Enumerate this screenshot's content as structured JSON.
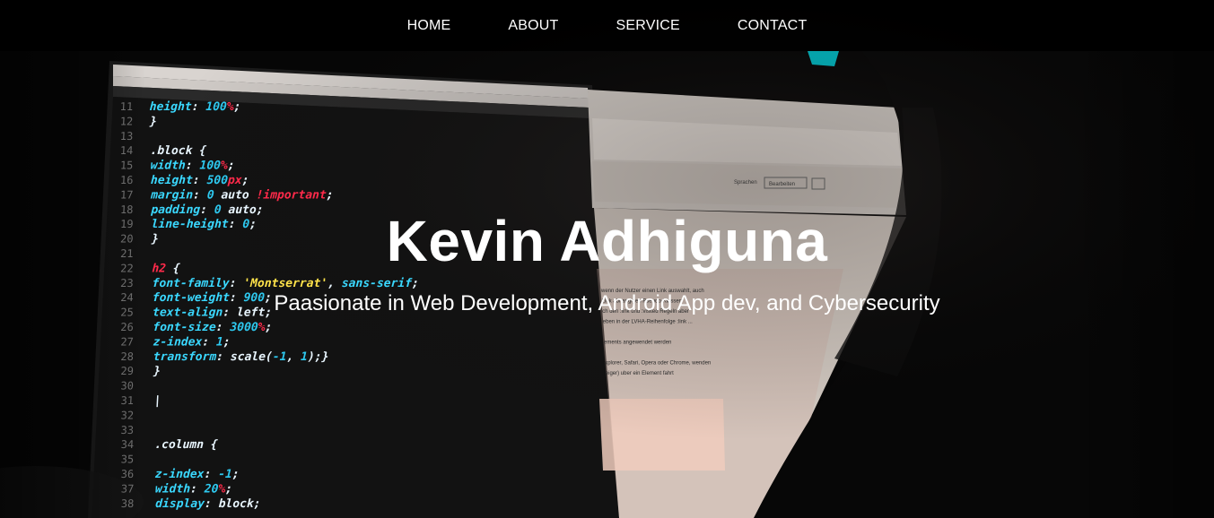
{
  "nav": {
    "items": [
      {
        "label": "HOME"
      },
      {
        "label": "ABOUT"
      },
      {
        "label": "SERVICE"
      },
      {
        "label": "CONTACT"
      }
    ]
  },
  "hero": {
    "title": "Kevin Adhiguna",
    "subtitle": "Paasionate in Web Development, Android App dev, and Cybersecurity"
  },
  "code_lines": [
    {
      "n": "11",
      "parts": [
        {
          "t": "    height",
          "c": "key"
        },
        {
          "t": ": ",
          "c": "w"
        },
        {
          "t": "100",
          "c": "num"
        },
        {
          "t": "%",
          "c": "unit"
        },
        {
          "t": ";",
          "c": "w"
        }
      ]
    },
    {
      "n": "12",
      "parts": [
        {
          "t": "}",
          "c": "w"
        }
      ]
    },
    {
      "n": "13",
      "parts": []
    },
    {
      "n": "14",
      "parts": [
        {
          "t": ".block {",
          "c": "w"
        }
      ]
    },
    {
      "n": "15",
      "parts": [
        {
          "t": "width",
          "c": "key"
        },
        {
          "t": ": ",
          "c": "w"
        },
        {
          "t": "100",
          "c": "num"
        },
        {
          "t": "%",
          "c": "unit"
        },
        {
          "t": ";",
          "c": "w"
        }
      ]
    },
    {
      "n": "16",
      "parts": [
        {
          "t": "height",
          "c": "key"
        },
        {
          "t": ": ",
          "c": "w"
        },
        {
          "t": "500",
          "c": "num"
        },
        {
          "t": "px",
          "c": "unit"
        },
        {
          "t": ";",
          "c": "w"
        }
      ]
    },
    {
      "n": "17",
      "parts": [
        {
          "t": "margin",
          "c": "key"
        },
        {
          "t": ": ",
          "c": "w"
        },
        {
          "t": "0",
          "c": "num"
        },
        {
          "t": " auto ",
          "c": "w"
        },
        {
          "t": "!important",
          "c": "unit"
        },
        {
          "t": ";",
          "c": "w"
        }
      ]
    },
    {
      "n": "18",
      "parts": [
        {
          "t": "padding",
          "c": "key"
        },
        {
          "t": ": ",
          "c": "w"
        },
        {
          "t": "0",
          "c": "num"
        },
        {
          "t": " auto;",
          "c": "w"
        }
      ]
    },
    {
      "n": "19",
      "parts": [
        {
          "t": "line-height",
          "c": "key"
        },
        {
          "t": ": ",
          "c": "w"
        },
        {
          "t": "0",
          "c": "num"
        },
        {
          "t": ";",
          "c": "w"
        }
      ]
    },
    {
      "n": "20",
      "parts": [
        {
          "t": "}",
          "c": "w"
        }
      ]
    },
    {
      "n": "21",
      "parts": []
    },
    {
      "n": "22",
      "parts": [
        {
          "t": "h2",
          "c": "unit"
        },
        {
          "t": " {",
          "c": "w"
        }
      ]
    },
    {
      "n": "23",
      "parts": [
        {
          "t": "    font-family",
          "c": "key"
        },
        {
          "t": ": ",
          "c": "w"
        },
        {
          "t": "'Montserrat'",
          "c": "str"
        },
        {
          "t": ", ",
          "c": "w"
        },
        {
          "t": "sans-serif",
          "c": "key"
        },
        {
          "t": ";",
          "c": "w"
        }
      ]
    },
    {
      "n": "24",
      "parts": [
        {
          "t": "    font-weight",
          "c": "key"
        },
        {
          "t": ": ",
          "c": "w"
        },
        {
          "t": "900",
          "c": "num"
        },
        {
          "t": ";",
          "c": "w"
        }
      ]
    },
    {
      "n": "25",
      "parts": [
        {
          "t": "    text-align",
          "c": "key"
        },
        {
          "t": ": left;",
          "c": "w"
        }
      ]
    },
    {
      "n": "26",
      "parts": [
        {
          "t": "    font-size",
          "c": "key"
        },
        {
          "t": ": ",
          "c": "w"
        },
        {
          "t": "3000",
          "c": "num"
        },
        {
          "t": "%",
          "c": "unit"
        },
        {
          "t": ";",
          "c": "w"
        }
      ]
    },
    {
      "n": "27",
      "parts": [
        {
          "t": "    z-index",
          "c": "key"
        },
        {
          "t": ": ",
          "c": "w"
        },
        {
          "t": "1",
          "c": "num"
        },
        {
          "t": ";",
          "c": "w"
        }
      ]
    },
    {
      "n": "28",
      "parts": [
        {
          "t": "    transform",
          "c": "key"
        },
        {
          "t": ": scale(",
          "c": "w"
        },
        {
          "t": "-1",
          "c": "num"
        },
        {
          "t": ", ",
          "c": "w"
        },
        {
          "t": "1",
          "c": "num"
        },
        {
          "t": ");}",
          "c": "w"
        }
      ]
    },
    {
      "n": "29",
      "parts": [
        {
          "t": "}",
          "c": "w"
        }
      ]
    },
    {
      "n": "30",
      "parts": []
    },
    {
      "n": "31",
      "parts": [
        {
          "t": "|",
          "c": "w"
        }
      ]
    },
    {
      "n": "32",
      "parts": []
    },
    {
      "n": "33",
      "parts": []
    },
    {
      "n": "34",
      "parts": [
        {
          "t": " .column {",
          "c": "w"
        }
      ]
    },
    {
      "n": "35",
      "parts": []
    },
    {
      "n": "36",
      "parts": [
        {
          "t": "    z-index",
          "c": "key"
        },
        {
          "t": ": ",
          "c": "w"
        },
        {
          "t": "-1",
          "c": "num"
        },
        {
          "t": ";",
          "c": "w"
        }
      ]
    },
    {
      "n": "37",
      "parts": [
        {
          "t": "    width",
          "c": "key"
        },
        {
          "t": ": ",
          "c": "w"
        },
        {
          "t": "20",
          "c": "num"
        },
        {
          "t": "%",
          "c": "unit"
        },
        {
          "t": ";",
          "c": "w"
        }
      ]
    },
    {
      "n": "38",
      "parts": [
        {
          "t": "    display",
          "c": "key"
        },
        {
          "t": ": block;",
          "c": "w"
        }
      ]
    }
  ],
  "right_doc_lines": [
    "wenn der Nutzer einen Link auswahlt, auch",
    "Link abhangigen Pseudo-Klassen",
    "ch den :link und :visited Regeln aber",
    "eben in der LVHA-Reihenfolge :link ...",
    "",
    "ements angewendet werden",
    "",
    "xplorer, Safari, Opera oder Chrome, wenden",
    "eiger) uber ein Element fahrt"
  ],
  "right_toolbar": {
    "speak": "Sprachen",
    "edit": "Bearbeiten"
  },
  "colors": {
    "key": "#3ad8ff",
    "num": "#2ec9f0",
    "unit": "#ff2a4a",
    "str": "#ffe24a",
    "w": "#e9f6ff",
    "accent": "#00c9d6"
  }
}
